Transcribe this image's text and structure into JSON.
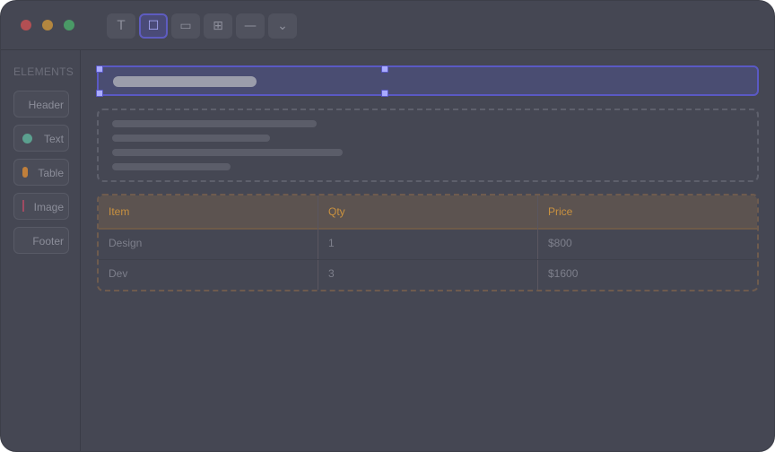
{
  "window": {
    "traffic_lights": [
      {
        "name": "close",
        "color": "#b24f53"
      },
      {
        "name": "minimize",
        "color": "#b3863f"
      },
      {
        "name": "maximize",
        "color": "#4a9a66"
      }
    ]
  },
  "toolbar": {
    "tools": [
      {
        "name": "text-tool",
        "glyph": "T",
        "active": false
      },
      {
        "name": "box-tool",
        "glyph": "☐",
        "active": true
      },
      {
        "name": "button-tool",
        "glyph": "▭",
        "active": false
      },
      {
        "name": "grid-tool",
        "glyph": "⊞",
        "active": false
      },
      {
        "name": "divider-tool",
        "glyph": "—",
        "active": false
      },
      {
        "name": "more-tool",
        "glyph": "⌄",
        "active": false
      }
    ]
  },
  "sidebar": {
    "title": "ELEMENTS",
    "items": [
      {
        "label": "Header"
      },
      {
        "label": "Text",
        "marker_color": "#5ba08f"
      },
      {
        "label": "Table",
        "marker_color": "#c07f3b"
      },
      {
        "label": "Image",
        "marker_color": "#a04a62"
      },
      {
        "label": "Footer"
      }
    ]
  },
  "canvas": {
    "table": {
      "columns": [
        "Item",
        "Qty",
        "Price"
      ],
      "rows": [
        [
          "Design",
          "1",
          "$800"
        ],
        [
          "Dev",
          "3",
          "$1600"
        ]
      ]
    }
  }
}
